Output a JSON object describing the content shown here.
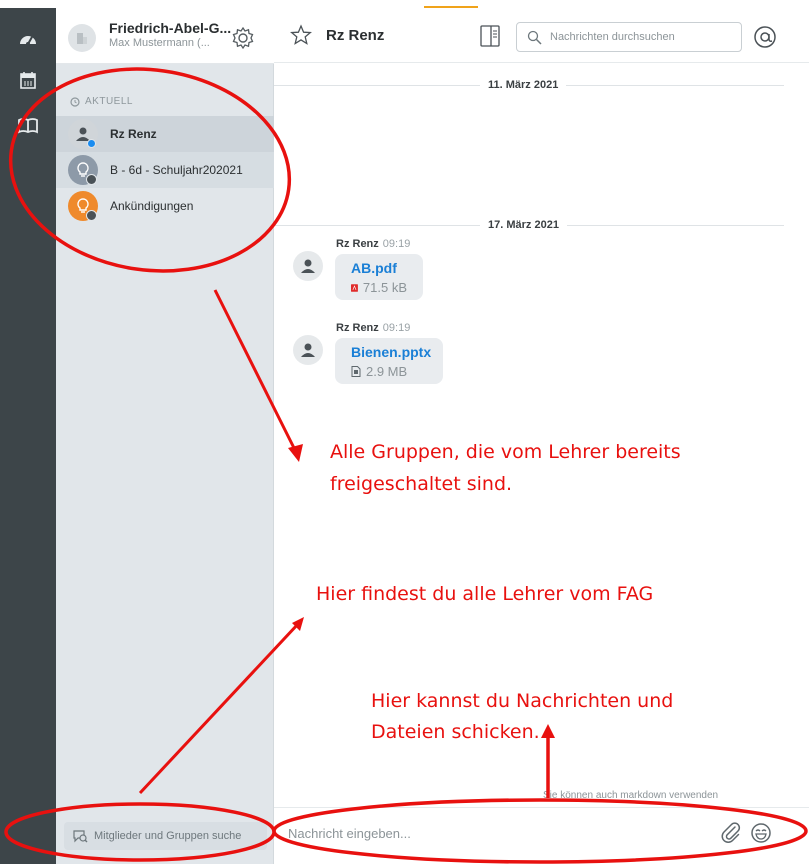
{
  "sidebar": {
    "org_name": "Friedrich-Abel-G...",
    "user_name": "Max Mustermann (...",
    "section_label": "AKTUELL",
    "chats": [
      {
        "label": "Rz Renz"
      },
      {
        "label": "B - 6d - Schuljahr202021"
      },
      {
        "label": "Ankündigungen"
      }
    ],
    "member_search_placeholder": "Mitglieder und Gruppen suche"
  },
  "chat": {
    "title": "Rz Renz",
    "search_placeholder": "Nachrichten durchsuchen",
    "dates": [
      "11. März 2021",
      "17. März 2021"
    ],
    "messages": [
      {
        "author": "Rz Renz",
        "time": "09:19",
        "file": "AB.pdf",
        "size": "71.5 kB",
        "type_icon": "pdf-icon"
      },
      {
        "author": "Rz Renz",
        "time": "09:19",
        "file": "Bienen.pptx",
        "size": "2.9 MB",
        "type_icon": "document-icon"
      }
    ],
    "markdown_hint": "Sie können auch markdown verwenden",
    "compose_placeholder": "Nachricht eingeben..."
  },
  "annotations": {
    "groups_1": "Alle Gruppen, die vom Lehrer bereits",
    "groups_2": "freigeschaltet sind.",
    "teachers": "Hier findest du alle Lehrer vom FAG",
    "send_1": "Hier kannst du Nachrichten und",
    "send_2": "Dateien schicken."
  },
  "colors": {
    "annotation": "#e8110f",
    "accent": "#f0a31a",
    "link": "#1a7fd6",
    "rail": "#3d4549"
  }
}
